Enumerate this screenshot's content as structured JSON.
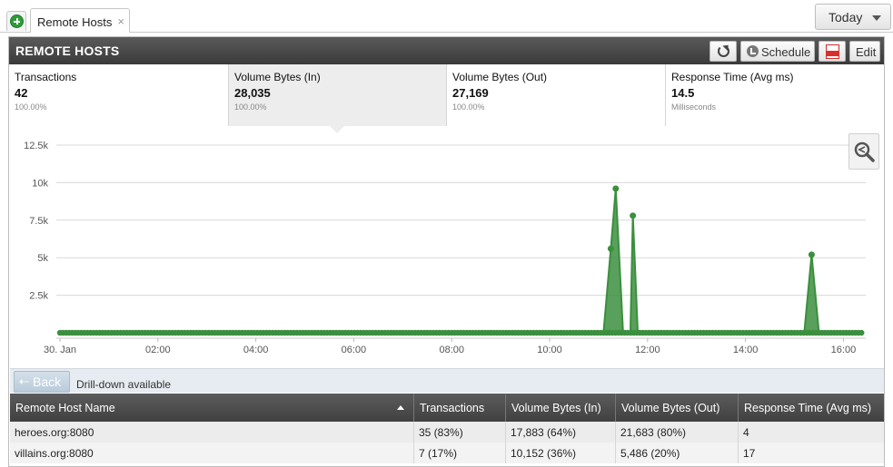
{
  "tabs": {
    "active_label": "Remote Hosts",
    "close_glyph": "×",
    "add_icon": "plus-circle-icon"
  },
  "period": {
    "label": "Today"
  },
  "panel": {
    "title": "REMOTE HOSTS",
    "buttons": {
      "schedule": "Schedule",
      "edit": "Edit"
    }
  },
  "metrics": [
    {
      "name": "Transactions",
      "value": "42",
      "sub": "100.00%"
    },
    {
      "name": "Volume Bytes (In)",
      "value": "28,035",
      "sub": "100.00%",
      "active": true
    },
    {
      "name": "Volume Bytes (Out)",
      "value": "27,169",
      "sub": "100.00%"
    },
    {
      "name": "Response Time (Avg ms)",
      "value": "14.5",
      "sub": "Milliseconds"
    }
  ],
  "chart_data": {
    "type": "area",
    "series": [
      {
        "values_note": "",
        "color": "#3b8f3e"
      }
    ],
    "x_ticks": [
      "30. Jan",
      "02:00",
      "04:00",
      "06:00",
      "08:00",
      "10:00",
      "12:00",
      "14:00",
      "16:00"
    ],
    "y_ticks": [
      "2.5k",
      "5k",
      "7.5k",
      "10k",
      "12.5k"
    ],
    "ylim": [
      0,
      12500
    ],
    "x_range_hours": [
      0,
      16.4
    ],
    "points": [
      {
        "x": 0.0,
        "y": 0
      },
      {
        "x": 11.1,
        "y": 0
      },
      {
        "x": 11.25,
        "y": 5600
      },
      {
        "x": 11.35,
        "y": 9600
      },
      {
        "x": 11.5,
        "y": 0
      },
      {
        "x": 11.65,
        "y": 0
      },
      {
        "x": 11.7,
        "y": 7800
      },
      {
        "x": 11.8,
        "y": 0
      },
      {
        "x": 15.2,
        "y": 0
      },
      {
        "x": 15.35,
        "y": 5200
      },
      {
        "x": 15.5,
        "y": 0
      },
      {
        "x": 16.4,
        "y": 0
      }
    ],
    "grid": true,
    "color": "#3b8f3e"
  },
  "drill": {
    "back_label": "Back",
    "text": "Drill-down available"
  },
  "table": {
    "columns": [
      "Remote Host Name",
      "Transactions",
      "Volume Bytes (In)",
      "Volume Bytes (Out)",
      "Response Time (Avg ms)"
    ],
    "rows": [
      [
        "heroes.org:8080",
        "35 (83%)",
        "17,883 (64%)",
        "21,683 (80%)",
        "4"
      ],
      [
        "villains.org:8080",
        "7 (17%)",
        "10,152 (36%)",
        "5,486 (20%)",
        "17"
      ]
    ]
  }
}
